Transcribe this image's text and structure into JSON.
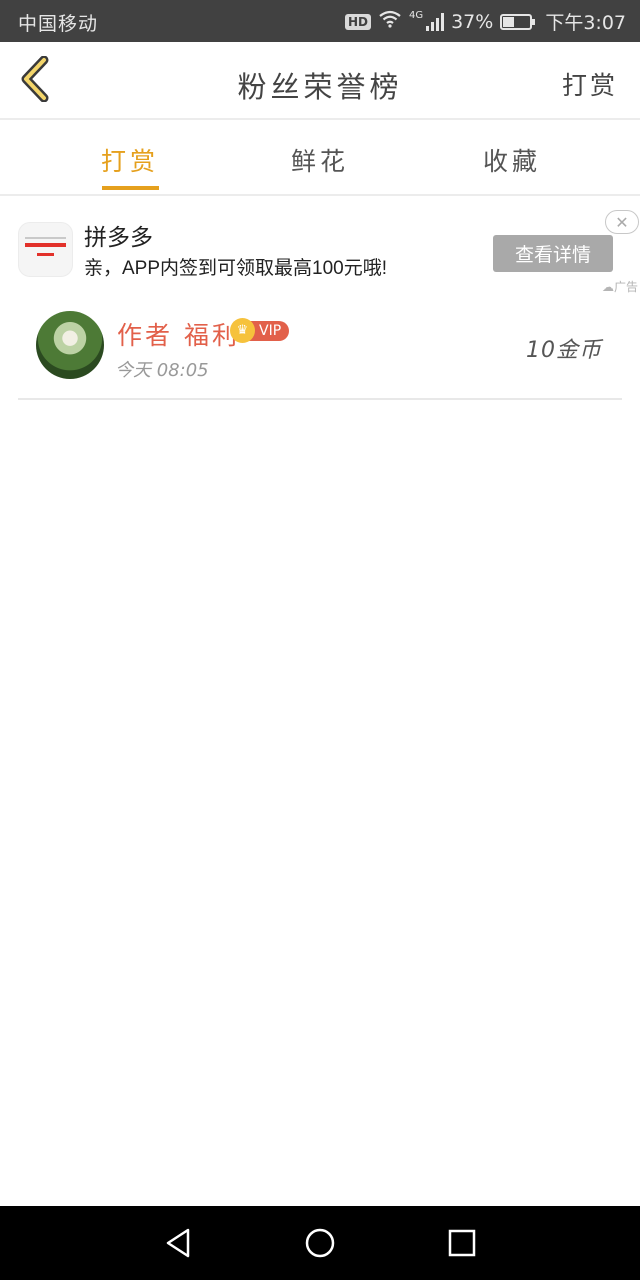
{
  "status_bar": {
    "carrier": "中国移动",
    "hd": "HD",
    "network": "4G",
    "battery": "37%",
    "battery_level": 0.37,
    "time": "下午3:07"
  },
  "header": {
    "back_icon": "chevron-left-icon",
    "title": "粉丝荣誉榜",
    "action": "打赏"
  },
  "tabs": [
    {
      "label": "打赏",
      "active": true
    },
    {
      "label": "鲜花",
      "active": false
    },
    {
      "label": "收藏",
      "active": false
    }
  ],
  "ad": {
    "title": "拼多多",
    "description": "亲，APP内签到可领取最高100元哦!",
    "button": "查看详情",
    "tag": "广告",
    "close_icon": "close-icon"
  },
  "rewards": [
    {
      "name": "作者 福利",
      "badge": "VIP",
      "time": "今天 08:05",
      "amount": "10金币"
    }
  ],
  "colors": {
    "accent": "#e5a01d",
    "name": "#e2604a",
    "status_bar": "#414141"
  },
  "nav_bar": {
    "back": "triangle-back-icon",
    "home": "circle-home-icon",
    "recents": "square-recents-icon"
  }
}
